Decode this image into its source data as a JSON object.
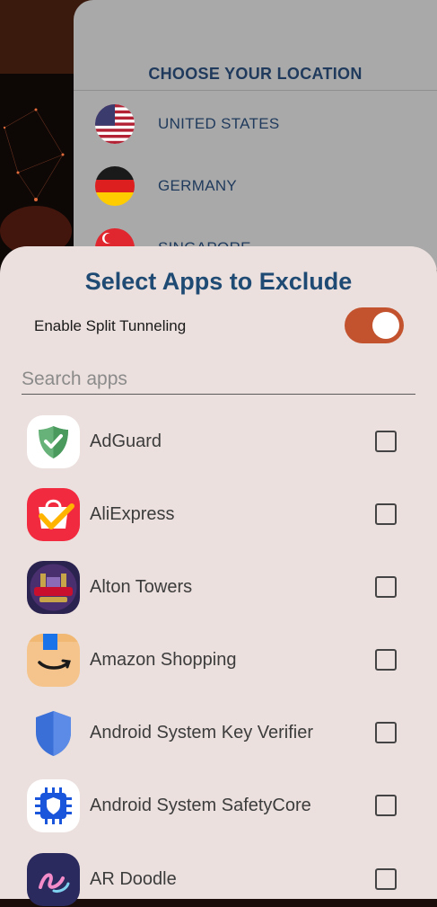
{
  "location_panel": {
    "title": "CHOOSE YOUR LOCATION",
    "countries": [
      {
        "name": "UNITED STATES",
        "flag": "us-flag-icon"
      },
      {
        "name": "GERMANY",
        "flag": "germany-flag-icon"
      },
      {
        "name": "SINGAPORE",
        "flag": "singapore-flag-icon"
      }
    ]
  },
  "sheet": {
    "title": "Select Apps to Exclude",
    "split_tunneling_label": "Enable Split Tunneling",
    "split_tunneling_enabled": true,
    "search_placeholder": "Search apps",
    "search_value": "",
    "apps": [
      {
        "name": "AdGuard",
        "icon": "adguard-icon",
        "checked": false
      },
      {
        "name": "AliExpress",
        "icon": "aliexpress-icon",
        "checked": false
      },
      {
        "name": "Alton Towers",
        "icon": "alton-towers-icon",
        "checked": false
      },
      {
        "name": "Amazon Shopping",
        "icon": "amazon-shopping-icon",
        "checked": false
      },
      {
        "name": "Android System Key Verifier",
        "icon": "key-verifier-icon",
        "checked": false
      },
      {
        "name": "Android System SafetyCore",
        "icon": "safetycore-icon",
        "checked": false
      },
      {
        "name": "AR Doodle",
        "icon": "ar-doodle-icon",
        "checked": false
      }
    ]
  },
  "colors": {
    "accent": "#c3532f",
    "title": "#1e4a73",
    "sheet_bg": "#ebe0dd"
  }
}
